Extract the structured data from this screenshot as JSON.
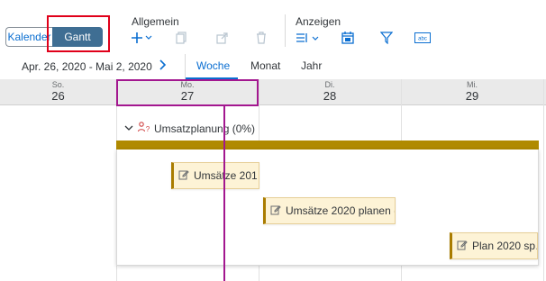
{
  "toolbar": {
    "view_switch": {
      "calendar": "Kalender",
      "gantt": "Gantt"
    },
    "general_label": "Allgemein",
    "display_label": "Anzeigen",
    "icons": {
      "add": "plus-icon",
      "copy": "copy-icon",
      "share": "share-icon",
      "delete": "trash-icon",
      "layout": "layout-icon",
      "calendar": "calendar-icon",
      "filter": "filter-icon",
      "abc": "text-icon"
    }
  },
  "nav": {
    "date_range": "Apr. 26, 2020 - Mai 2, 2020",
    "tabs": [
      "Woche",
      "Monat",
      "Jahr"
    ]
  },
  "timeline": {
    "days": [
      {
        "name": "So.",
        "num": "26"
      },
      {
        "name": "Mo.",
        "num": "27"
      },
      {
        "name": "Di.",
        "num": "28"
      },
      {
        "name": "Mi.",
        "num": "29"
      }
    ]
  },
  "gantt": {
    "group_label": "Umsatzplanung (0%)",
    "tasks": [
      "Umsätze 201…",
      "Umsätze 2020 planen (…",
      "Plan 2020 sp…"
    ]
  },
  "colors": {
    "accent": "#0a6ed1",
    "gantt_button": "#3f6e93",
    "summary_bar": "#b08a00",
    "today_marker": "#a3178f",
    "highlight": "#e0001a"
  }
}
